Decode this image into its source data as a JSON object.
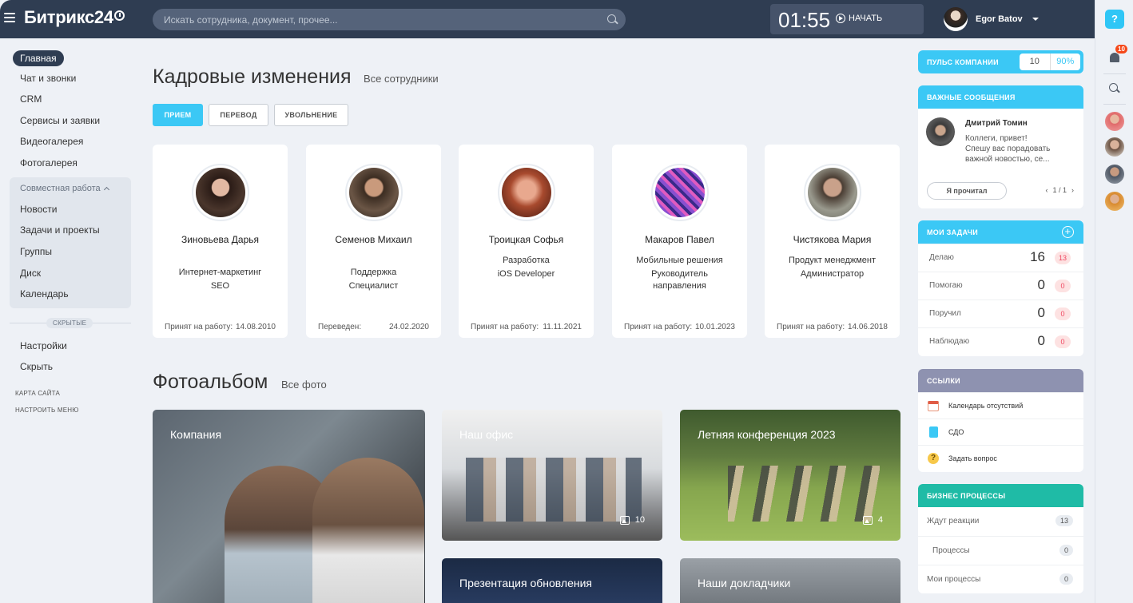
{
  "header": {
    "logo": "Битрикс24",
    "search_placeholder": "Искать сотрудника, документ, прочее...",
    "time": "01:55",
    "start_label": "НАЧАТЬ",
    "user_name": "Egor Batov"
  },
  "sidebar": {
    "items": [
      {
        "label": "Главная"
      },
      {
        "label": "Чат и звонки"
      },
      {
        "label": "CRM"
      },
      {
        "label": "Сервисы и заявки"
      },
      {
        "label": "Видеогалерея"
      },
      {
        "label": "Фотогалерея"
      }
    ],
    "group": {
      "title": "Совместная работа",
      "items": [
        {
          "label": "Новости"
        },
        {
          "label": "Задачи и проекты"
        },
        {
          "label": "Группы"
        },
        {
          "label": "Диск"
        },
        {
          "label": "Календарь"
        }
      ]
    },
    "hidden_label": "СКРЫТЫЕ",
    "bottom_items": [
      {
        "label": "Настройки"
      },
      {
        "label": "Скрыть"
      }
    ],
    "sitemap": "КАРТА САЙТА",
    "configure_menu": "НАСТРОИТЬ МЕНЮ"
  },
  "hr": {
    "title": "Кадровые изменения",
    "all_link": "Все сотрудники",
    "tabs": [
      "ПРИЕМ",
      "ПЕРЕВОД",
      "УВОЛЬНЕНИЕ"
    ],
    "cards": [
      {
        "name": "Зиновьева Дарья",
        "line1": "Интернет-маркетинг",
        "line2": "SEO",
        "line3": "",
        "foot_label": "Принят на работу:",
        "foot_date": "14.08.2010",
        "avatar_bg": "#3a2a24"
      },
      {
        "name": "Семенов Михаил",
        "line1": "Поддержка",
        "line2": "Специалист",
        "line3": "",
        "foot_label": "Переведен:",
        "foot_date": "24.02.2020",
        "avatar_bg": "#5a4a3e"
      },
      {
        "name": "Троицкая Софья",
        "line1": "Разработка",
        "line2": "iOS Developer",
        "line3": "",
        "foot_label": "Принят на работу:",
        "foot_date": "11.11.2021",
        "avatar_bg": "#b5573c"
      },
      {
        "name": "Макаров Павел",
        "line1": "Мобильные решения",
        "line2": "Руководитель",
        "line3": "направления",
        "foot_label": "Принят на работу:",
        "foot_date": "10.01.2023",
        "avatar_bg": "#7b4fb5"
      },
      {
        "name": "Чистякова Мария",
        "line1": "Продукт менеджмент",
        "line2": "Администратор",
        "line3": "",
        "foot_label": "Принят на работу:",
        "foot_date": "14.06.2018",
        "avatar_bg": "#8a8a80"
      }
    ]
  },
  "album": {
    "title": "Фотоальбом",
    "all_link": "Все фото",
    "photos": [
      {
        "title": "Компания",
        "count": ""
      },
      {
        "title": "Наш офис",
        "count": "10"
      },
      {
        "title": "Летняя конференция 2023",
        "count": "4"
      },
      {
        "title": "Презентация обновления",
        "count": ""
      },
      {
        "title": "Наши докладчики",
        "count": ""
      }
    ]
  },
  "widgets": {
    "pulse": {
      "title": "ПУЛЬС КОМПАНИИ",
      "value": "10",
      "percent": "90%"
    },
    "messages": {
      "title": "ВАЖНЫЕ СООБЩЕНИЯ",
      "author": "Дмитрий Томин",
      "text1": "Коллеги, привет!",
      "text2": "Спешу вас порадовать",
      "text3": "важной новостью, се...",
      "read_button": "Я прочитал",
      "pager": "1 / 1"
    },
    "tasks": {
      "title": "МОИ ЗАДАЧИ",
      "rows": [
        {
          "label": "Делаю",
          "count": "16",
          "badge": "13"
        },
        {
          "label": "Помогаю",
          "count": "0",
          "badge": "0"
        },
        {
          "label": "Поручил",
          "count": "0",
          "badge": "0"
        },
        {
          "label": "Наблюдаю",
          "count": "0",
          "badge": "0"
        }
      ]
    },
    "links": {
      "title": "ССЫЛКИ",
      "items": [
        {
          "label": "Календарь отсутствий"
        },
        {
          "label": "СДО"
        },
        {
          "label": "Задать вопрос"
        }
      ]
    },
    "bp": {
      "title": "БИЗНЕС ПРОЦЕССЫ",
      "rows": [
        {
          "label": "Ждут реакции",
          "count": "13"
        },
        {
          "label": "Процессы",
          "count": "0"
        },
        {
          "label": "Мои процессы",
          "count": "0"
        }
      ]
    }
  },
  "rightbar": {
    "notifications": "10",
    "help": "?"
  },
  "colors": {
    "accent": "#3bc8f5",
    "header": "#2f3d52",
    "links_head": "#8e92b0",
    "bp_head": "#1fbba6"
  }
}
